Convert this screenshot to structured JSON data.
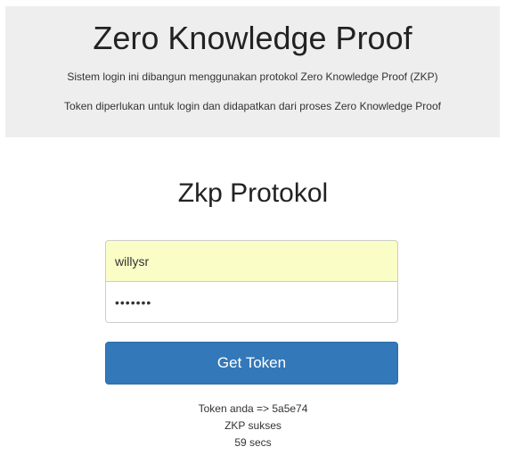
{
  "header": {
    "title": "Zero Knowledge Proof",
    "description_1": "Sistem login ini dibangun menggunakan protokol Zero Knowledge Proof (ZKP)",
    "description_2": "Token diperlukan untuk login dan didapatkan dari proses Zero Knowledge Proof"
  },
  "form": {
    "title": "Zkp Protokol",
    "username_value": "willysr",
    "password_value": "•••••••",
    "submit_label": "Get Token"
  },
  "result": {
    "token_line": "Token anda => 5a5e74",
    "status_line": "ZKP sukses",
    "timer_line": "59 secs"
  }
}
